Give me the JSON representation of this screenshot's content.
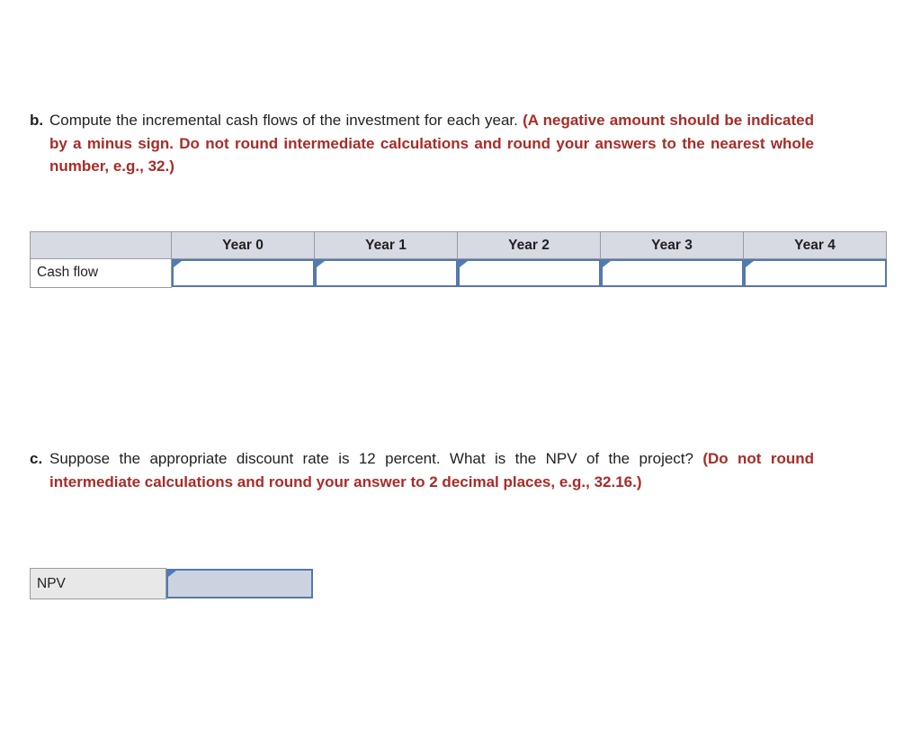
{
  "colors": {
    "note_red": "#a82c28",
    "header_fill": "#d7dae3",
    "input_border": "#5479ad",
    "input_flag": "#4a7ebb",
    "npv_input_fill": "#ccd3e0",
    "npv_label_fill": "#e8e8e8",
    "text": "#231f20"
  },
  "question_b": {
    "marker": "b.",
    "prompt": "Compute the incremental cash flows of the investment for each year. ",
    "note": "(A negative amount should be indicated by a minus sign. Do not round intermediate calculations and round your answers to the nearest whole number, e.g., 32.)"
  },
  "question_c": {
    "marker": "c.",
    "prompt": "Suppose the appropriate discount rate is 12 percent. What is the NPV of the project? ",
    "note": "(Do not round intermediate calculations and round your answer to 2 decimal places, e.g., 32.16.)"
  },
  "cashflow_table": {
    "corner_header": "",
    "columns": [
      "Year 0",
      "Year 1",
      "Year 2",
      "Year 3",
      "Year 4"
    ],
    "row_label": "Cash flow",
    "values": [
      "",
      "",
      "",
      "",
      ""
    ],
    "placeholders": [
      "",
      "",
      "",
      "",
      ""
    ],
    "flag_icon": "input-marker-triangle-icon"
  },
  "npv_row": {
    "label": "NPV",
    "value": "",
    "placeholder": "",
    "flag_icon": "input-marker-triangle-icon"
  }
}
